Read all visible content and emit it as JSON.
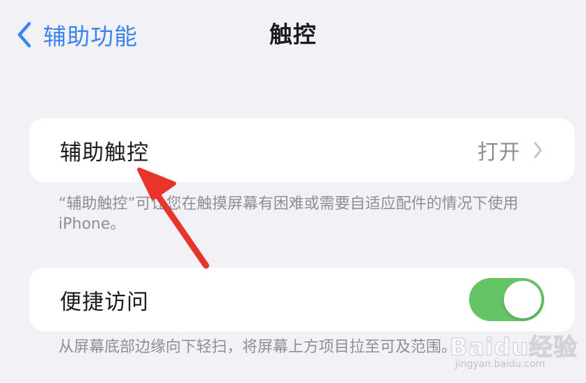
{
  "nav": {
    "back_label": "辅助功能",
    "title": "触控",
    "back_icon": "chevron-left-icon"
  },
  "assistive_touch": {
    "label": "辅助触控",
    "value": "打开",
    "chevron_icon": "chevron-right-icon",
    "footnote": "“辅助触控”可让您在触摸屏幕有困难或需要自适应配件的情况下使用iPhone。"
  },
  "reachability": {
    "label": "便捷访问",
    "toggle_on": true,
    "toggle_color": "#65c466",
    "footnote": "从屏幕底部边缘向下轻扫，将屏幕上方项目拉至可及范围。"
  },
  "annotation": {
    "type": "red-arrow",
    "color": "#e8352c"
  },
  "watermark": {
    "main": "Baidu经验",
    "sub": "jingyan.baidu.com"
  },
  "colors": {
    "background": "#f2f1f6",
    "accent": "#3a84f2"
  }
}
